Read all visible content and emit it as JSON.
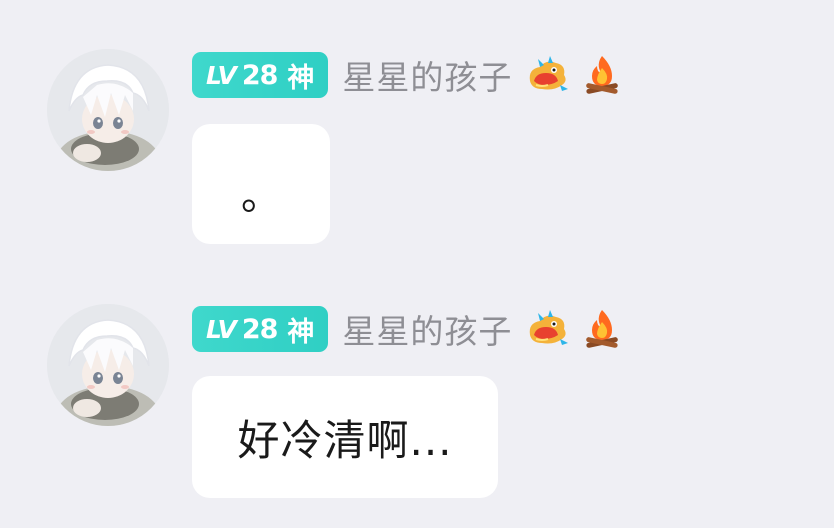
{
  "messages": [
    {
      "user": {
        "level_prefix": "LV",
        "level": "28",
        "rank": "神",
        "name": "星星的孩子",
        "decorations": [
          "dragon-icon",
          "campfire-icon"
        ]
      },
      "text": "。"
    },
    {
      "user": {
        "level_prefix": "LV",
        "level": "28",
        "rank": "神",
        "name": "星星的孩子",
        "decorations": [
          "dragon-icon",
          "campfire-icon"
        ]
      },
      "text": "好冷清啊..."
    }
  ],
  "colors": {
    "background": "#efeff4",
    "badge": "#36d3c8",
    "username": "#8e8e94",
    "bubble": "#ffffff"
  }
}
